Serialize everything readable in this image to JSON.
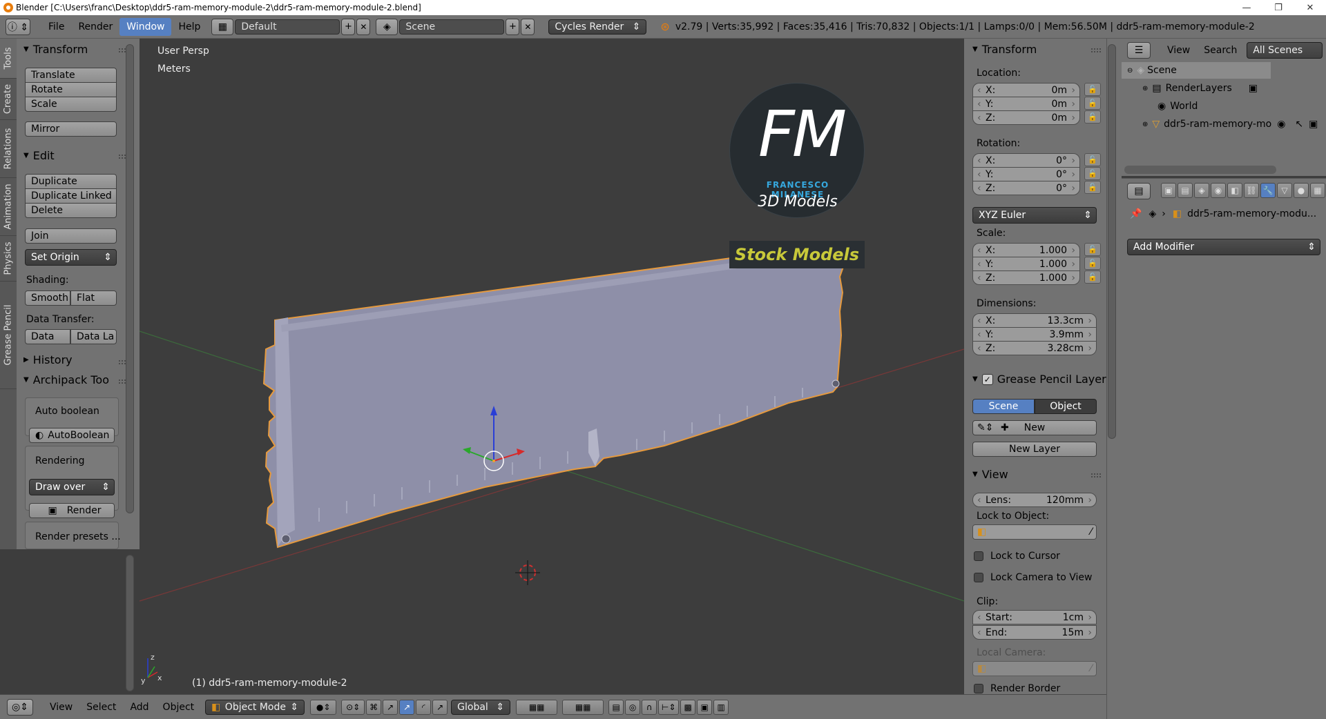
{
  "window": {
    "title": "Blender [C:\\Users\\franc\\Desktop\\ddr5-ram-memory-module-2\\ddr5-ram-memory-module-2.blend]",
    "controls": [
      "—",
      "❐",
      "✕"
    ]
  },
  "topbar": {
    "menus": [
      "File",
      "Render",
      "Window",
      "Help"
    ],
    "active_menu": "Window",
    "screen_layout": "Default",
    "scene": "Scene",
    "render_engine": "Cycles Render",
    "stats": "v2.79 | Verts:35,992 | Faces:35,416 | Tris:70,832 | Objects:1/1 | Lamps:0/0 | Mem:56.50M | ddr5-ram-memory-module-2"
  },
  "vtabs": [
    "Tools",
    "Create",
    "Relations",
    "Animation",
    "Physics",
    "Grease Pencil"
  ],
  "toolshelf": {
    "transform_title": "Transform",
    "transform_buttons": [
      "Translate",
      "Rotate",
      "Scale"
    ],
    "mirror": "Mirror",
    "edit_title": "Edit",
    "edit_buttons": [
      "Duplicate",
      "Duplicate Linked",
      "Delete"
    ],
    "join": "Join",
    "set_origin": "Set Origin",
    "shading_label": "Shading:",
    "smooth": "Smooth",
    "flat": "Flat",
    "data_transfer_label": "Data Transfer:",
    "data": "Data",
    "data_la": "Data La",
    "history_title": "History",
    "archipack_title": "Archipack Too",
    "auto_boolean_label": "Auto boolean",
    "autoboolean_btn": "AutoBoolean",
    "rendering_label": "Rendering",
    "draw_over": "Draw over",
    "render_btn": "Render",
    "render_presets": "Render presets ..."
  },
  "viewport": {
    "view_name": "User Persp",
    "units": "Meters",
    "object_label": "(1) ddr5-ram-memory-module-2",
    "watermark_initials": "FM",
    "watermark_name": "FRANCESCO MILANESE",
    "watermark_sub": "3D Models",
    "watermark_banner": "Stock Models"
  },
  "npanel": {
    "transform_title": "Transform",
    "location_label": "Location:",
    "location": [
      {
        "axis": "X:",
        "value": "0m"
      },
      {
        "axis": "Y:",
        "value": "0m"
      },
      {
        "axis": "Z:",
        "value": "0m"
      }
    ],
    "rotation_label": "Rotation:",
    "rotation": [
      {
        "axis": "X:",
        "value": "0°"
      },
      {
        "axis": "Y:",
        "value": "0°"
      },
      {
        "axis": "Z:",
        "value": "0°"
      }
    ],
    "rotation_mode": "XYZ Euler",
    "scale_label": "Scale:",
    "scale": [
      {
        "axis": "X:",
        "value": "1.000"
      },
      {
        "axis": "Y:",
        "value": "1.000"
      },
      {
        "axis": "Z:",
        "value": "1.000"
      }
    ],
    "dimensions_label": "Dimensions:",
    "dimensions": [
      {
        "axis": "X:",
        "value": "13.3cm"
      },
      {
        "axis": "Y:",
        "value": "3.9mm"
      },
      {
        "axis": "Z:",
        "value": "3.28cm"
      }
    ],
    "grease_title": "Grease Pencil Layer",
    "scene_tab": "Scene",
    "object_tab": "Object",
    "new": "New",
    "new_layer": "New Layer",
    "view_title": "View",
    "lens_label": "Lens:",
    "lens_value": "120mm",
    "lock_to_object": "Lock to Object:",
    "lock_to_cursor": "Lock to Cursor",
    "lock_camera": "Lock Camera to View",
    "clip_label": "Clip:",
    "clip_start_label": "Start:",
    "clip_start": "1cm",
    "clip_end_label": "End:",
    "clip_end": "15m",
    "local_camera": "Local Camera:",
    "render_border": "Render Border"
  },
  "outliner": {
    "menus": [
      "View",
      "Search"
    ],
    "filter": "All Scenes",
    "items": [
      "Scene",
      "RenderLayers",
      "World",
      "ddr5-ram-memory-mo"
    ]
  },
  "properties": {
    "object_name": "ddr5-ram-memory-modu...",
    "add_modifier": "Add Modifier"
  },
  "bottombar": {
    "menus": [
      "View",
      "Select",
      "Add",
      "Object"
    ],
    "mode": "Object Mode",
    "orientation": "Global"
  },
  "colors": {
    "accent": "#5680c2",
    "panel": "#727272",
    "viewport": "#3d3d3d",
    "mesh": "#8e8fa8",
    "watermark_banner_text": "#c8c93a"
  }
}
